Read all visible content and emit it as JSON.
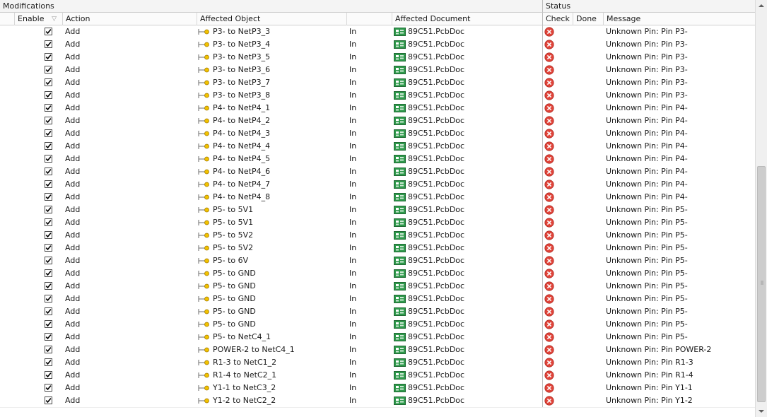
{
  "groups": {
    "modifications": "Modifications",
    "status": "Status"
  },
  "columns": {
    "enable": "Enable",
    "action": "Action",
    "affected_object": "Affected Object",
    "affected_document": "Affected Document",
    "check": "Check",
    "done": "Done",
    "message": "Message"
  },
  "colors": {
    "error": "#e0443a",
    "pcb_green": "#1f7a3a",
    "object_icon": "#d9a400"
  },
  "icons": {
    "enable_sort": "sort-indicator-icon",
    "object": "net-connection-icon",
    "document": "pcb-document-icon",
    "check": "error-icon",
    "checkbox": "checkmark-icon"
  },
  "rows": [
    {
      "enabled": true,
      "action": "Add",
      "object": "P3- to NetP3_3",
      "direction": "In",
      "document": "89C51.PcbDoc",
      "message": "Unknown Pin: Pin P3-"
    },
    {
      "enabled": true,
      "action": "Add",
      "object": "P3- to NetP3_4",
      "direction": "In",
      "document": "89C51.PcbDoc",
      "message": "Unknown Pin: Pin P3-"
    },
    {
      "enabled": true,
      "action": "Add",
      "object": "P3- to NetP3_5",
      "direction": "In",
      "document": "89C51.PcbDoc",
      "message": "Unknown Pin: Pin P3-"
    },
    {
      "enabled": true,
      "action": "Add",
      "object": "P3- to NetP3_6",
      "direction": "In",
      "document": "89C51.PcbDoc",
      "message": "Unknown Pin: Pin P3-"
    },
    {
      "enabled": true,
      "action": "Add",
      "object": "P3- to NetP3_7",
      "direction": "In",
      "document": "89C51.PcbDoc",
      "message": "Unknown Pin: Pin P3-"
    },
    {
      "enabled": true,
      "action": "Add",
      "object": "P3- to NetP3_8",
      "direction": "In",
      "document": "89C51.PcbDoc",
      "message": "Unknown Pin: Pin P3-"
    },
    {
      "enabled": true,
      "action": "Add",
      "object": "P4- to NetP4_1",
      "direction": "In",
      "document": "89C51.PcbDoc",
      "message": "Unknown Pin: Pin P4-"
    },
    {
      "enabled": true,
      "action": "Add",
      "object": "P4- to NetP4_2",
      "direction": "In",
      "document": "89C51.PcbDoc",
      "message": "Unknown Pin: Pin P4-"
    },
    {
      "enabled": true,
      "action": "Add",
      "object": "P4- to NetP4_3",
      "direction": "In",
      "document": "89C51.PcbDoc",
      "message": "Unknown Pin: Pin P4-"
    },
    {
      "enabled": true,
      "action": "Add",
      "object": "P4- to NetP4_4",
      "direction": "In",
      "document": "89C51.PcbDoc",
      "message": "Unknown Pin: Pin P4-"
    },
    {
      "enabled": true,
      "action": "Add",
      "object": "P4- to NetP4_5",
      "direction": "In",
      "document": "89C51.PcbDoc",
      "message": "Unknown Pin: Pin P4-"
    },
    {
      "enabled": true,
      "action": "Add",
      "object": "P4- to NetP4_6",
      "direction": "In",
      "document": "89C51.PcbDoc",
      "message": "Unknown Pin: Pin P4-"
    },
    {
      "enabled": true,
      "action": "Add",
      "object": "P4- to NetP4_7",
      "direction": "In",
      "document": "89C51.PcbDoc",
      "message": "Unknown Pin: Pin P4-"
    },
    {
      "enabled": true,
      "action": "Add",
      "object": "P4- to NetP4_8",
      "direction": "In",
      "document": "89C51.PcbDoc",
      "message": "Unknown Pin: Pin P4-"
    },
    {
      "enabled": true,
      "action": "Add",
      "object": "P5- to 5V1",
      "direction": "In",
      "document": "89C51.PcbDoc",
      "message": "Unknown Pin: Pin P5-"
    },
    {
      "enabled": true,
      "action": "Add",
      "object": "P5- to 5V1",
      "direction": "In",
      "document": "89C51.PcbDoc",
      "message": "Unknown Pin: Pin P5-"
    },
    {
      "enabled": true,
      "action": "Add",
      "object": "P5- to 5V2",
      "direction": "In",
      "document": "89C51.PcbDoc",
      "message": "Unknown Pin: Pin P5-"
    },
    {
      "enabled": true,
      "action": "Add",
      "object": "P5- to 5V2",
      "direction": "In",
      "document": "89C51.PcbDoc",
      "message": "Unknown Pin: Pin P5-"
    },
    {
      "enabled": true,
      "action": "Add",
      "object": "P5- to 6V",
      "direction": "In",
      "document": "89C51.PcbDoc",
      "message": "Unknown Pin: Pin P5-"
    },
    {
      "enabled": true,
      "action": "Add",
      "object": "P5- to GND",
      "direction": "In",
      "document": "89C51.PcbDoc",
      "message": "Unknown Pin: Pin P5-"
    },
    {
      "enabled": true,
      "action": "Add",
      "object": "P5- to GND",
      "direction": "In",
      "document": "89C51.PcbDoc",
      "message": "Unknown Pin: Pin P5-"
    },
    {
      "enabled": true,
      "action": "Add",
      "object": "P5- to GND",
      "direction": "In",
      "document": "89C51.PcbDoc",
      "message": "Unknown Pin: Pin P5-"
    },
    {
      "enabled": true,
      "action": "Add",
      "object": "P5- to GND",
      "direction": "In",
      "document": "89C51.PcbDoc",
      "message": "Unknown Pin: Pin P5-"
    },
    {
      "enabled": true,
      "action": "Add",
      "object": "P5- to GND",
      "direction": "In",
      "document": "89C51.PcbDoc",
      "message": "Unknown Pin: Pin P5-"
    },
    {
      "enabled": true,
      "action": "Add",
      "object": "P5- to NetC4_1",
      "direction": "In",
      "document": "89C51.PcbDoc",
      "message": "Unknown Pin: Pin P5-"
    },
    {
      "enabled": true,
      "action": "Add",
      "object": "POWER-2 to NetC4_1",
      "direction": "In",
      "document": "89C51.PcbDoc",
      "message": "Unknown Pin: Pin POWER-2"
    },
    {
      "enabled": true,
      "action": "Add",
      "object": "R1-3 to NetC1_2",
      "direction": "In",
      "document": "89C51.PcbDoc",
      "message": "Unknown Pin: Pin R1-3"
    },
    {
      "enabled": true,
      "action": "Add",
      "object": "R1-4 to NetC2_1",
      "direction": "In",
      "document": "89C51.PcbDoc",
      "message": "Unknown Pin: Pin R1-4"
    },
    {
      "enabled": true,
      "action": "Add",
      "object": "Y1-1 to NetC3_2",
      "direction": "In",
      "document": "89C51.PcbDoc",
      "message": "Unknown Pin: Pin Y1-1"
    },
    {
      "enabled": true,
      "action": "Add",
      "object": "Y1-2 to NetC2_2",
      "direction": "In",
      "document": "89C51.PcbDoc",
      "message": "Unknown Pin: Pin Y1-2"
    }
  ]
}
